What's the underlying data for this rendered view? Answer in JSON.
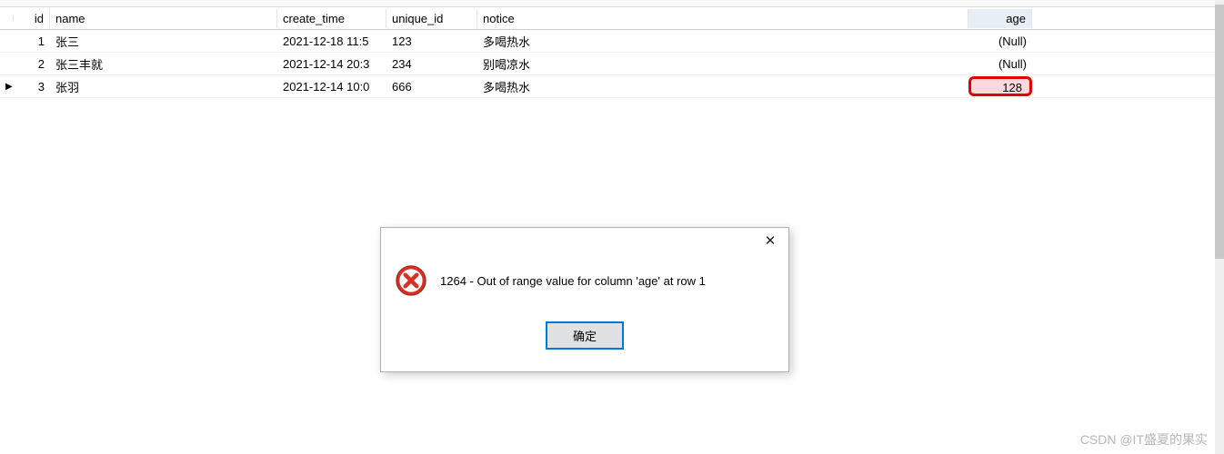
{
  "table": {
    "columns": {
      "id": "id",
      "name": "name",
      "create_time": "create_time",
      "unique_id": "unique_id",
      "notice": "notice",
      "age": "age"
    },
    "null_label": "(Null)",
    "rows": [
      {
        "indicator": "",
        "id": "1",
        "name": "张三",
        "create_time": "2021-12-18 11:5",
        "unique_id": "123",
        "notice": "多喝热水",
        "age": null
      },
      {
        "indicator": "",
        "id": "2",
        "name": "张三丰就",
        "create_time": "2021-12-14 20:3",
        "unique_id": "234",
        "notice": "别喝凉水",
        "age": null
      },
      {
        "indicator": "▶",
        "id": "3",
        "name": "张羽",
        "create_time": "2021-12-14 10:0",
        "unique_id": "666",
        "notice": "多喝热水",
        "age": "128"
      }
    ],
    "highlight": {
      "row_index": 2,
      "column": "age"
    }
  },
  "dialog": {
    "message": "1264 - Out of range value for column 'age' at row 1",
    "ok_label": "确定",
    "close_symbol": "✕"
  },
  "watermark": "CSDN @IT盛夏的果实"
}
